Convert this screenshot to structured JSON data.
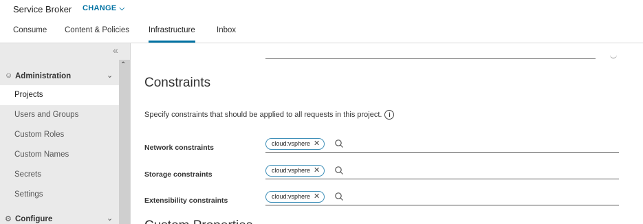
{
  "header": {
    "app_title": "Service Broker",
    "change_label": "CHANGE",
    "tabs": [
      {
        "label": "Consume"
      },
      {
        "label": "Content & Policies"
      },
      {
        "label": "Infrastructure"
      },
      {
        "label": "Inbox"
      }
    ]
  },
  "sidebar": {
    "groups": [
      {
        "label": "Administration",
        "icon": "users-group-icon"
      },
      {
        "label": "Configure",
        "icon": "gear-icon"
      }
    ],
    "items": [
      {
        "label": "Projects"
      },
      {
        "label": "Users and Groups"
      },
      {
        "label": "Custom Roles"
      },
      {
        "label": "Custom Names"
      },
      {
        "label": "Secrets"
      },
      {
        "label": "Settings"
      }
    ]
  },
  "main": {
    "section_title": "Constraints",
    "description": "Specify constraints that should be applied to all requests in this project.",
    "constraints": [
      {
        "label": "Network constraints",
        "chip": "cloud:vsphere"
      },
      {
        "label": "Storage constraints",
        "chip": "cloud:vsphere"
      },
      {
        "label": "Extensibility constraints",
        "chip": "cloud:vsphere"
      }
    ],
    "next_section_title": "Custom Properties"
  },
  "colors": {
    "accent": "#0072a3",
    "chip_border": "#3e8fb8",
    "sidebar_bg": "#eaeaea"
  }
}
